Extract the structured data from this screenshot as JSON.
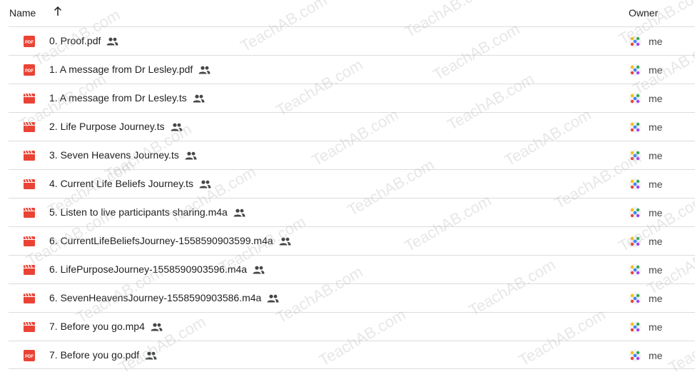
{
  "header": {
    "name_label": "Name",
    "owner_label": "Owner",
    "sort_icon": "arrow-up-icon"
  },
  "files": [
    {
      "name": "0. Proof.pdf",
      "type": "pdf",
      "owner": "me"
    },
    {
      "name": "1. A message from Dr Lesley.pdf",
      "type": "pdf",
      "owner": "me"
    },
    {
      "name": "1. A message from Dr Lesley.ts",
      "type": "video",
      "owner": "me"
    },
    {
      "name": "2. Life Purpose Journey.ts",
      "type": "video",
      "owner": "me"
    },
    {
      "name": "3. Seven Heavens Journey.ts",
      "type": "video",
      "owner": "me"
    },
    {
      "name": "4. Current Life Beliefs Journey.ts",
      "type": "video",
      "owner": "me"
    },
    {
      "name": "5. Listen to live participants sharing.m4a",
      "type": "video",
      "owner": "me"
    },
    {
      "name": "6. CurrentLifeBeliefsJourney-1558590903599.m4a",
      "type": "video",
      "owner": "me"
    },
    {
      "name": "6. LifePurposeJourney-1558590903596.m4a",
      "type": "video",
      "owner": "me"
    },
    {
      "name": "6. SevenHeavensJourney-1558590903586.m4a",
      "type": "video",
      "owner": "me"
    },
    {
      "name": "7. Before you go.mp4",
      "type": "video",
      "owner": "me"
    },
    {
      "name": "7. Before you go.pdf",
      "type": "pdf",
      "owner": "me"
    }
  ],
  "icons": {
    "pdf": "pdf-file-icon",
    "video": "video-file-icon",
    "shared": "shared-people-icon",
    "avatar": "owner-avatar-icon"
  },
  "colors": {
    "file_icon_red": "#ea4335",
    "divider": "#dadce0"
  },
  "watermark": "TeachAB.com"
}
